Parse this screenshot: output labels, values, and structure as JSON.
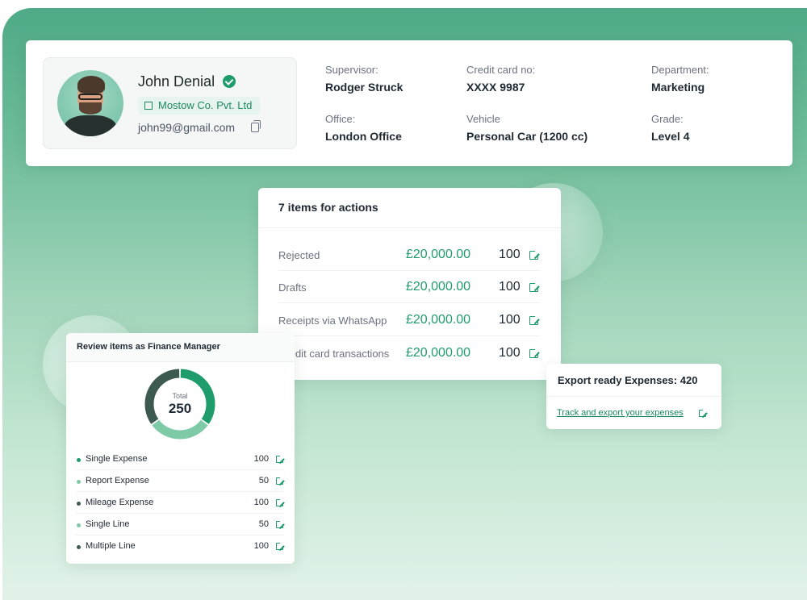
{
  "profile": {
    "name": "John Denial",
    "company": "Mostow Co. Pvt. Ltd",
    "email": "john99@gmail.com",
    "fields": {
      "supervisor": {
        "label": "Supervisor:",
        "value": "Rodger Struck"
      },
      "credit_card": {
        "label": "Credit card no:",
        "value": "XXXX 9987"
      },
      "department": {
        "label": "Department:",
        "value": "Marketing"
      },
      "office": {
        "label": "Office:",
        "value": "London Office"
      },
      "vehicle": {
        "label": "Vehicle",
        "value": "Personal Car (1200 cc)"
      },
      "grade": {
        "label": "Grade:",
        "value": "Level 4"
      }
    }
  },
  "actions": {
    "title": "7 items for actions",
    "rows": [
      {
        "label": "Rejected",
        "amount": "£20,000.00",
        "count": "100"
      },
      {
        "label": "Drafts",
        "amount": "£20,000.00",
        "count": "100"
      },
      {
        "label": "Receipts via WhatsApp",
        "amount": "£20,000.00",
        "count": "100"
      },
      {
        "label": "Credit card transactions",
        "amount": "£20,000.00",
        "count": "100"
      }
    ]
  },
  "export": {
    "title": "Export ready Expenses: 420",
    "link": "Track and export your expenses"
  },
  "review": {
    "title": "Review items as Finance Manager",
    "total_label": "Total",
    "total_value": "250",
    "rows": [
      {
        "label": "Single Expense",
        "count": "100",
        "color": "#1f9c6c"
      },
      {
        "label": "Report Expense",
        "count": "50",
        "color": "#7fcaa6"
      },
      {
        "label": "Mileage Expense",
        "count": "100",
        "color": "#3c5a50"
      },
      {
        "label": "Single Line",
        "count": "50",
        "color": "#7fcaa6"
      },
      {
        "label": "Multiple Line",
        "count": "100",
        "color": "#3c5a50"
      }
    ],
    "donut_segments": [
      {
        "value": 35,
        "color": "#1f9c6c"
      },
      {
        "value": 30,
        "color": "#7fcaa6"
      },
      {
        "value": 35,
        "color": "#3c5a50"
      }
    ]
  },
  "colors": {
    "accent": "#1f9c6c",
    "background_top": "#4faa86"
  },
  "icons": [
    "verified-badge-icon",
    "building-icon",
    "copy-icon",
    "external-link-icon"
  ]
}
